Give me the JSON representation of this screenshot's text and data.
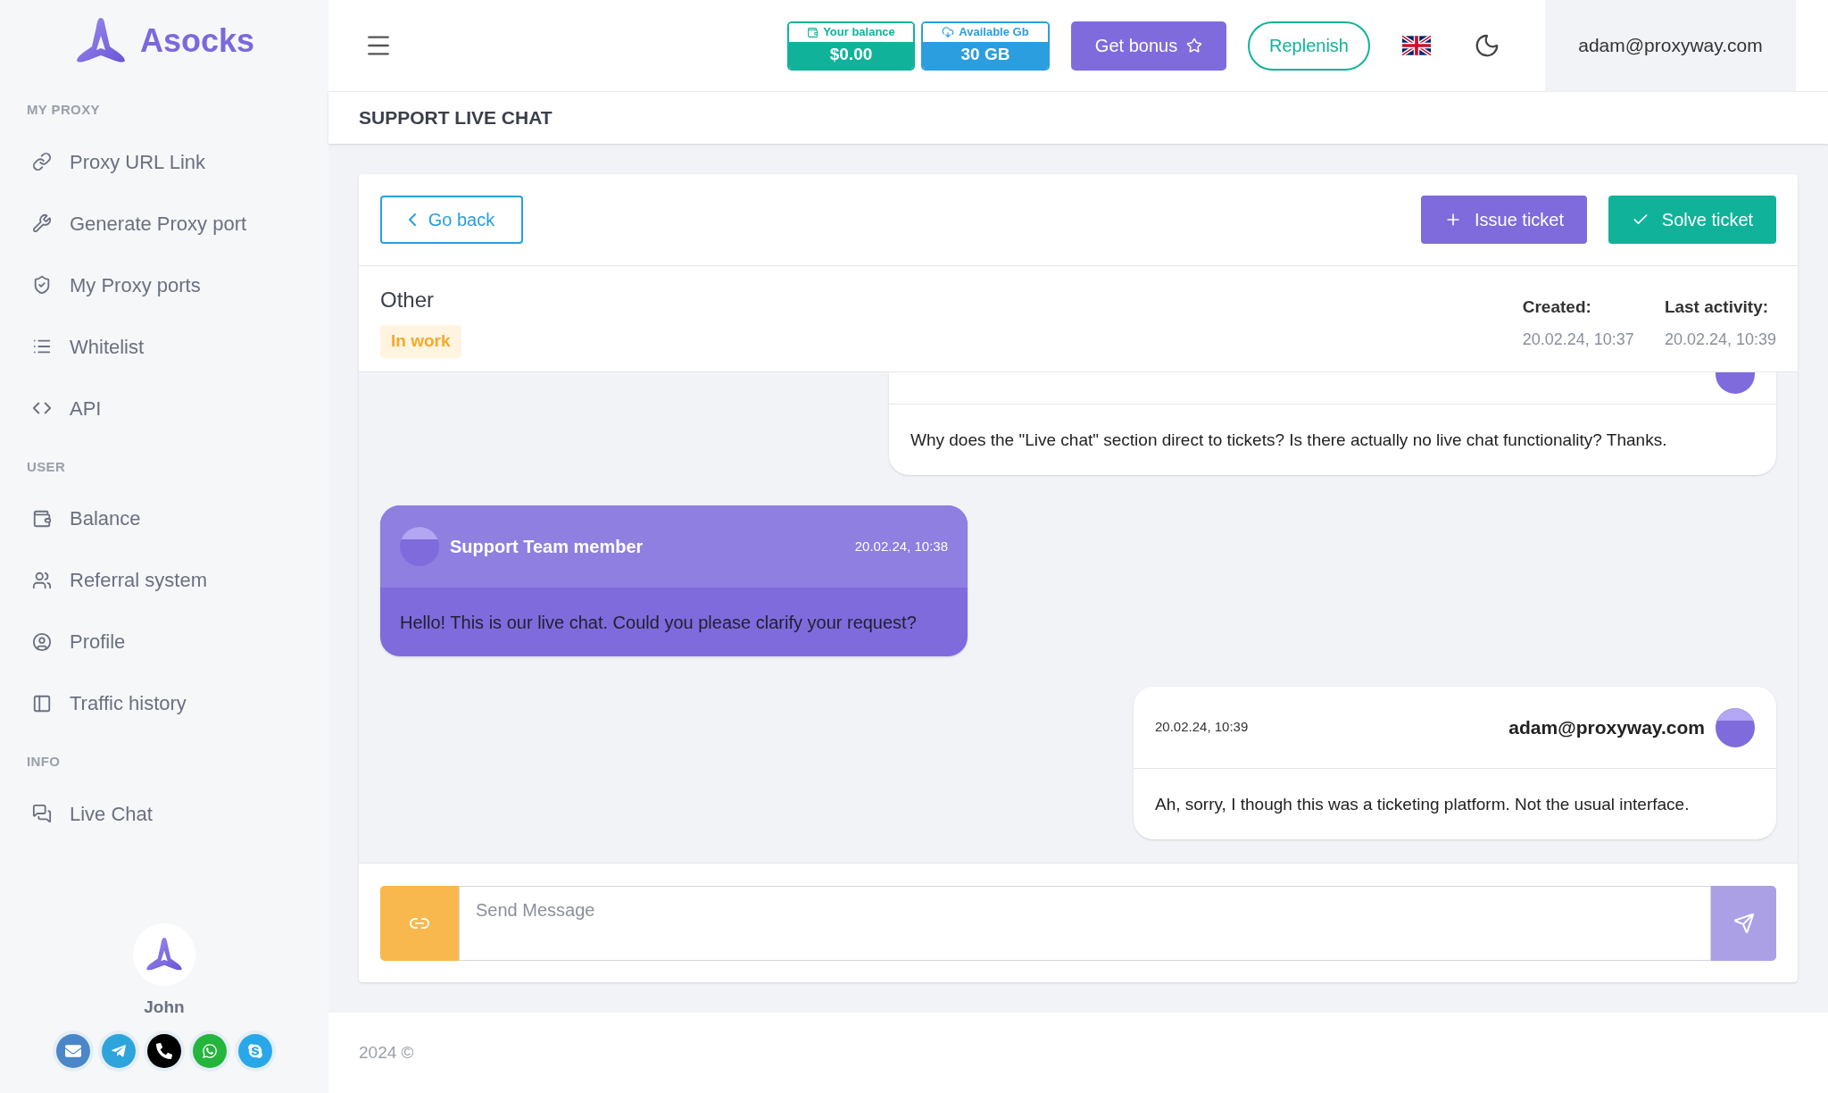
{
  "brand": {
    "name": "Asocks"
  },
  "sidebar": {
    "sections": [
      {
        "title": "MY PROXY",
        "items": [
          {
            "label": "Proxy URL Link"
          },
          {
            "label": "Generate Proxy port"
          },
          {
            "label": "My Proxy ports"
          },
          {
            "label": "Whitelist"
          },
          {
            "label": "API"
          }
        ]
      },
      {
        "title": "USER",
        "items": [
          {
            "label": "Balance"
          },
          {
            "label": "Referral system"
          },
          {
            "label": "Profile"
          },
          {
            "label": "Traffic history"
          }
        ]
      },
      {
        "title": "INFO",
        "items": [
          {
            "label": "Live Chat"
          }
        ]
      }
    ]
  },
  "user": {
    "name": "John"
  },
  "topbar": {
    "balance": {
      "label": "Your balance",
      "value": "$0.00"
    },
    "traffic": {
      "label": "Available Gb",
      "value": "30 GB"
    },
    "bonus_button": "Get bonus",
    "replenish_button": "Replenish",
    "account": "adam@proxyway.com"
  },
  "page_title": "SUPPORT LIVE CHAT",
  "toolbar": {
    "back": "Go back",
    "issue": "Issue ticket",
    "solve": "Solve ticket"
  },
  "ticket": {
    "subject": "Other",
    "status": "In work",
    "created_label": "Created:",
    "created": "20.02.24, 10:37",
    "activity_label": "Last activity:",
    "activity": "20.02.24, 10:39"
  },
  "messages": [
    {
      "from_self": true,
      "text": "Why does the \"Live chat\" section direct to tickets? Is there actually no live chat functionality? Thanks."
    },
    {
      "from_self": false,
      "author": "Support Team member",
      "time": "20.02.24, 10:38",
      "text": "Hello! This is our live chat. Could you please clarify your request?"
    },
    {
      "from_self": true,
      "author": "adam@proxyway.com",
      "time": "20.02.24, 10:39",
      "text": "Ah, sorry, I though this was a ticketing platform. Not the usual interface."
    }
  ],
  "composer": {
    "placeholder": "Send Message"
  },
  "footer": "2024 ©"
}
